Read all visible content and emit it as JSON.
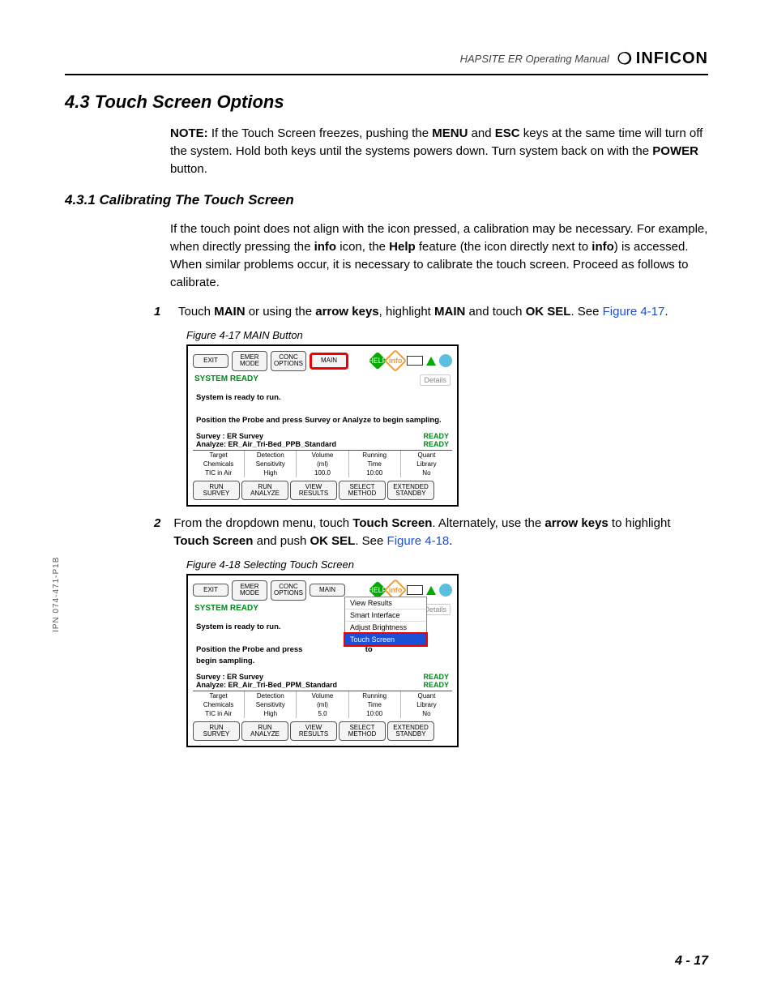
{
  "header": {
    "manual_title": "HAPSITE ER Operating Manual",
    "brand": "INFICON"
  },
  "section": {
    "number_title": "4.3  Touch Screen Options",
    "note_label": "NOTE:",
    "note_body_a": "If the Touch Screen freezes, pushing the ",
    "note_b1": "MENU",
    "note_body_b": " and ",
    "note_b2": "ESC",
    "note_body_c": " keys at the same time will turn off the system. Hold both keys until the systems powers down. Turn system back on with the ",
    "note_b3": "POWER",
    "note_body_d": " button."
  },
  "subsection": {
    "number_title": "4.3.1  Calibrating The Touch Screen",
    "para_a": "If the touch point does not align with the icon pressed, a calibration may be necessary. For example, when directly pressing the ",
    "b_info": "info",
    "para_b": " icon, the ",
    "b_help": "Help",
    "para_c": " feature (the icon directly next to ",
    "para_d": ") is accessed. When similar problems occur, it is necessary to calibrate the touch screen. Proceed as follows to calibrate."
  },
  "step1": {
    "num": "1",
    "a": "Touch ",
    "b1": "MAIN",
    "b": " or using the ",
    "b2": "arrow keys",
    "c": ", highlight ",
    "b3": "MAIN",
    "d": " and touch ",
    "b4": "OK SEL",
    "e": ". See ",
    "ref": "Figure 4-17",
    "f": "."
  },
  "fig17": {
    "caption": "Figure 4-17  MAIN Button"
  },
  "step2": {
    "num": "2",
    "a": "From the dropdown menu, touch ",
    "b1": "Touch Screen",
    "b": ". Alternately, use the ",
    "b2": "arrow keys",
    "c": " to highlight ",
    "b3": "Touch Screen",
    "d": " and push ",
    "b4": "OK SEL",
    "e": ". See ",
    "ref": "Figure 4-18",
    "f": "."
  },
  "fig18": {
    "caption": "Figure 4-18  Selecting Touch Screen"
  },
  "device": {
    "top": {
      "exit": "EXIT",
      "emer": "EMER\nMODE",
      "conc": "CONC\nOPTIONS",
      "main": "MAIN"
    },
    "status": "SYSTEM READY",
    "details": "Details",
    "body1": "System is ready to run.",
    "body2": "Position the Probe and press Survey or Analyze to begin sampling.",
    "body2_cut": "Position the Probe and press",
    "body2_tail": "to",
    "survey": "Survey : ER Survey",
    "analyze17": "Analyze: ER_Air_Tri-Bed_PPB_Standard",
    "analyze18": "Analyze: ER_Air_Tri-Bed_PPM_Standard",
    "ready": "READY",
    "cols": [
      "Target",
      "Detection",
      "Volume",
      "Running",
      "Quant"
    ],
    "cols2": [
      "Chemicals",
      "Sensitivity",
      "(ml)",
      "Time",
      "Library"
    ],
    "vals17": [
      "TIC in Air",
      "High",
      "100.0",
      "10:00",
      "No"
    ],
    "vals18": [
      "TIC in Air",
      "High",
      "5.0",
      "10:00",
      "No"
    ],
    "bottom": [
      "RUN\nSURVEY",
      "RUN\nANALYZE",
      "VIEW\nRESULTS",
      "SELECT\nMETHOD",
      "EXTENDED\nSTANDBY"
    ]
  },
  "dropdown": {
    "items": [
      "View Results",
      "Smart Interface",
      "Adjust Brightness",
      "Touch Screen"
    ]
  },
  "side_label": "IPN 074-471-P1B",
  "page_number": "4 - 17"
}
